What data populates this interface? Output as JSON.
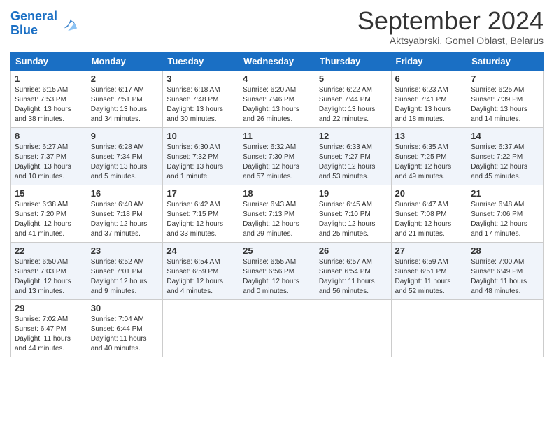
{
  "header": {
    "logo_line1": "General",
    "logo_line2": "Blue",
    "month_title": "September 2024",
    "subtitle": "Aktsyabrski, Gomel Oblast, Belarus"
  },
  "weekdays": [
    "Sunday",
    "Monday",
    "Tuesday",
    "Wednesday",
    "Thursday",
    "Friday",
    "Saturday"
  ],
  "weeks": [
    [
      {
        "day": "1",
        "sunrise": "Sunrise: 6:15 AM",
        "sunset": "Sunset: 7:53 PM",
        "daylight": "Daylight: 13 hours and 38 minutes."
      },
      {
        "day": "2",
        "sunrise": "Sunrise: 6:17 AM",
        "sunset": "Sunset: 7:51 PM",
        "daylight": "Daylight: 13 hours and 34 minutes."
      },
      {
        "day": "3",
        "sunrise": "Sunrise: 6:18 AM",
        "sunset": "Sunset: 7:48 PM",
        "daylight": "Daylight: 13 hours and 30 minutes."
      },
      {
        "day": "4",
        "sunrise": "Sunrise: 6:20 AM",
        "sunset": "Sunset: 7:46 PM",
        "daylight": "Daylight: 13 hours and 26 minutes."
      },
      {
        "day": "5",
        "sunrise": "Sunrise: 6:22 AM",
        "sunset": "Sunset: 7:44 PM",
        "daylight": "Daylight: 13 hours and 22 minutes."
      },
      {
        "day": "6",
        "sunrise": "Sunrise: 6:23 AM",
        "sunset": "Sunset: 7:41 PM",
        "daylight": "Daylight: 13 hours and 18 minutes."
      },
      {
        "day": "7",
        "sunrise": "Sunrise: 6:25 AM",
        "sunset": "Sunset: 7:39 PM",
        "daylight": "Daylight: 13 hours and 14 minutes."
      }
    ],
    [
      {
        "day": "8",
        "sunrise": "Sunrise: 6:27 AM",
        "sunset": "Sunset: 7:37 PM",
        "daylight": "Daylight: 13 hours and 10 minutes."
      },
      {
        "day": "9",
        "sunrise": "Sunrise: 6:28 AM",
        "sunset": "Sunset: 7:34 PM",
        "daylight": "Daylight: 13 hours and 5 minutes."
      },
      {
        "day": "10",
        "sunrise": "Sunrise: 6:30 AM",
        "sunset": "Sunset: 7:32 PM",
        "daylight": "Daylight: 13 hours and 1 minute."
      },
      {
        "day": "11",
        "sunrise": "Sunrise: 6:32 AM",
        "sunset": "Sunset: 7:30 PM",
        "daylight": "Daylight: 12 hours and 57 minutes."
      },
      {
        "day": "12",
        "sunrise": "Sunrise: 6:33 AM",
        "sunset": "Sunset: 7:27 PM",
        "daylight": "Daylight: 12 hours and 53 minutes."
      },
      {
        "day": "13",
        "sunrise": "Sunrise: 6:35 AM",
        "sunset": "Sunset: 7:25 PM",
        "daylight": "Daylight: 12 hours and 49 minutes."
      },
      {
        "day": "14",
        "sunrise": "Sunrise: 6:37 AM",
        "sunset": "Sunset: 7:22 PM",
        "daylight": "Daylight: 12 hours and 45 minutes."
      }
    ],
    [
      {
        "day": "15",
        "sunrise": "Sunrise: 6:38 AM",
        "sunset": "Sunset: 7:20 PM",
        "daylight": "Daylight: 12 hours and 41 minutes."
      },
      {
        "day": "16",
        "sunrise": "Sunrise: 6:40 AM",
        "sunset": "Sunset: 7:18 PM",
        "daylight": "Daylight: 12 hours and 37 minutes."
      },
      {
        "day": "17",
        "sunrise": "Sunrise: 6:42 AM",
        "sunset": "Sunset: 7:15 PM",
        "daylight": "Daylight: 12 hours and 33 minutes."
      },
      {
        "day": "18",
        "sunrise": "Sunrise: 6:43 AM",
        "sunset": "Sunset: 7:13 PM",
        "daylight": "Daylight: 12 hours and 29 minutes."
      },
      {
        "day": "19",
        "sunrise": "Sunrise: 6:45 AM",
        "sunset": "Sunset: 7:10 PM",
        "daylight": "Daylight: 12 hours and 25 minutes."
      },
      {
        "day": "20",
        "sunrise": "Sunrise: 6:47 AM",
        "sunset": "Sunset: 7:08 PM",
        "daylight": "Daylight: 12 hours and 21 minutes."
      },
      {
        "day": "21",
        "sunrise": "Sunrise: 6:48 AM",
        "sunset": "Sunset: 7:06 PM",
        "daylight": "Daylight: 12 hours and 17 minutes."
      }
    ],
    [
      {
        "day": "22",
        "sunrise": "Sunrise: 6:50 AM",
        "sunset": "Sunset: 7:03 PM",
        "daylight": "Daylight: 12 hours and 13 minutes."
      },
      {
        "day": "23",
        "sunrise": "Sunrise: 6:52 AM",
        "sunset": "Sunset: 7:01 PM",
        "daylight": "Daylight: 12 hours and 9 minutes."
      },
      {
        "day": "24",
        "sunrise": "Sunrise: 6:54 AM",
        "sunset": "Sunset: 6:59 PM",
        "daylight": "Daylight: 12 hours and 4 minutes."
      },
      {
        "day": "25",
        "sunrise": "Sunrise: 6:55 AM",
        "sunset": "Sunset: 6:56 PM",
        "daylight": "Daylight: 12 hours and 0 minutes."
      },
      {
        "day": "26",
        "sunrise": "Sunrise: 6:57 AM",
        "sunset": "Sunset: 6:54 PM",
        "daylight": "Daylight: 11 hours and 56 minutes."
      },
      {
        "day": "27",
        "sunrise": "Sunrise: 6:59 AM",
        "sunset": "Sunset: 6:51 PM",
        "daylight": "Daylight: 11 hours and 52 minutes."
      },
      {
        "day": "28",
        "sunrise": "Sunrise: 7:00 AM",
        "sunset": "Sunset: 6:49 PM",
        "daylight": "Daylight: 11 hours and 48 minutes."
      }
    ],
    [
      {
        "day": "29",
        "sunrise": "Sunrise: 7:02 AM",
        "sunset": "Sunset: 6:47 PM",
        "daylight": "Daylight: 11 hours and 44 minutes."
      },
      {
        "day": "30",
        "sunrise": "Sunrise: 7:04 AM",
        "sunset": "Sunset: 6:44 PM",
        "daylight": "Daylight: 11 hours and 40 minutes."
      },
      null,
      null,
      null,
      null,
      null
    ]
  ]
}
